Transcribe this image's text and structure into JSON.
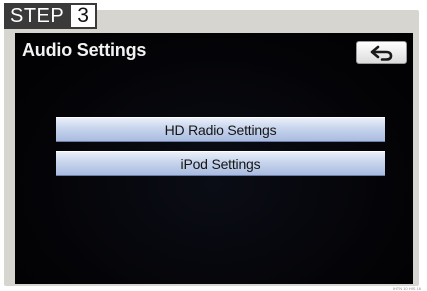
{
  "step": {
    "word": "STEP",
    "number": "3"
  },
  "screen": {
    "title": "Audio Settings",
    "back_button": {
      "icon": "return-arrow-icon"
    },
    "menu": [
      {
        "label": "HD Radio Settings"
      },
      {
        "label": "iPod Settings"
      }
    ]
  },
  "image_code": "IHTN 10 HIS 16",
  "colors": {
    "screen_background": "#040408",
    "button_blue": "#c7d4ec",
    "step_badge": "#3a3a3a",
    "frame": "#d7d5cf"
  }
}
